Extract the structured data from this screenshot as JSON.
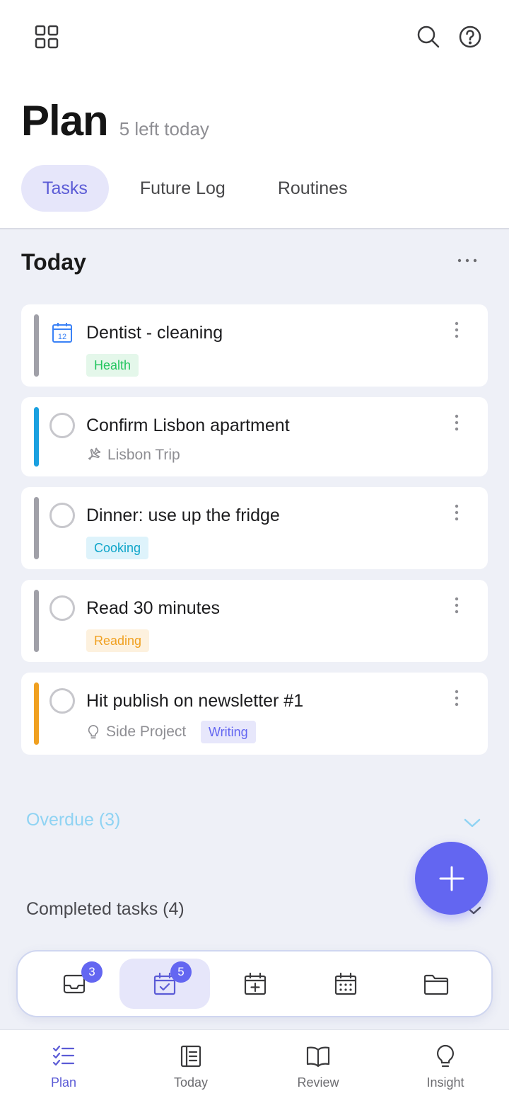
{
  "header": {
    "title": "Plan",
    "subtitle": "5 left today"
  },
  "tabs": [
    {
      "label": "Tasks",
      "active": true
    },
    {
      "label": "Future Log",
      "active": false
    },
    {
      "label": "Routines",
      "active": false
    }
  ],
  "section": {
    "title": "Today"
  },
  "tasks": [
    {
      "title": "Dentist - cleaning",
      "bar_color": "#a0a0a8",
      "icon": "calendar-icon",
      "tag": "Health",
      "tag_color": "#22c55e",
      "tag_bg": "#e4f7ea"
    },
    {
      "title": "Confirm Lisbon apartment",
      "bar_color": "#1aa0e0",
      "meta_icon": "airplane-icon",
      "meta": "Lisbon Trip"
    },
    {
      "title": "Dinner: use up the fridge",
      "bar_color": "#a0a0a8",
      "tag": "Cooking",
      "tag_color": "#0ea5c9",
      "tag_bg": "#def3fb"
    },
    {
      "title": "Read 30 minutes",
      "bar_color": "#a0a0a8",
      "tag": "Reading",
      "tag_color": "#f0a020",
      "tag_bg": "#fdf1de"
    },
    {
      "title": "Hit publish on newsletter #1",
      "bar_color": "#f0a020",
      "meta_icon": "lightbulb-icon",
      "meta": "Side Project",
      "tag": "Writing",
      "tag_color": "#6366f1",
      "tag_bg": "#e7e7fb"
    }
  ],
  "groups": {
    "overdue": "Overdue (3)",
    "completed": "Completed tasks (4)"
  },
  "dock": {
    "inbox_badge": "3",
    "today_badge": "5"
  },
  "nav": [
    {
      "label": "Plan",
      "icon": "checklist-icon",
      "active": true
    },
    {
      "label": "Today",
      "icon": "journal-icon",
      "active": false
    },
    {
      "label": "Review",
      "icon": "book-icon",
      "active": false
    },
    {
      "label": "Insight",
      "icon": "lightbulb-icon",
      "active": false
    }
  ],
  "colors": {
    "accent": "#6366f1",
    "background": "#eef0f7"
  }
}
